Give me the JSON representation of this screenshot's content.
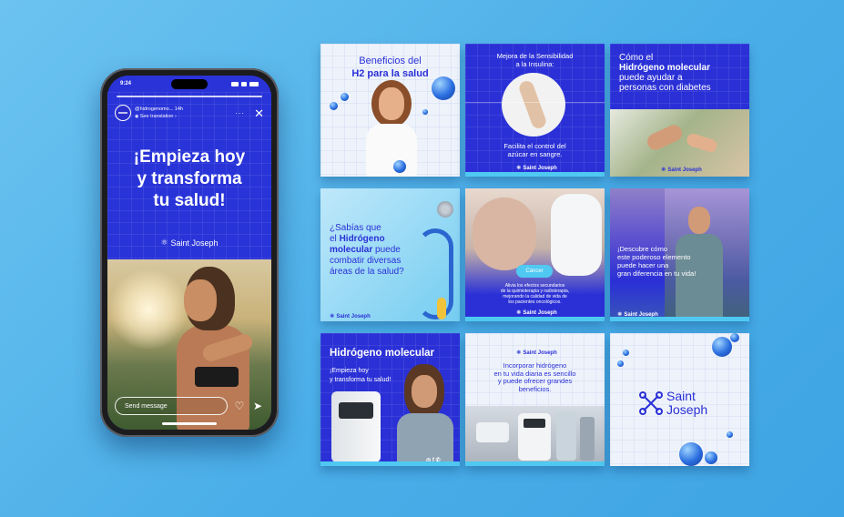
{
  "phone": {
    "status_time": "9:24",
    "story": {
      "username": "@hidrogenomo... 14h",
      "see_translation": "See translation",
      "title_lines": [
        "¡Empieza hoy",
        "y transforma",
        "tu salud!"
      ],
      "brand": "Saint Joseph",
      "send_placeholder": "Send message"
    }
  },
  "tiles": {
    "t1": {
      "line1": "Beneficios del",
      "line2": "H2 para la salud"
    },
    "t2": {
      "top1": "Mejora de la Sensibilidad",
      "top2": "a la Insulina:",
      "bottom1": "Facilita el control del",
      "bottom2": "azúcar en sangre.",
      "brand": "Saint Joseph"
    },
    "t3": {
      "l1": "Cómo el",
      "l2": "Hidrógeno molecular",
      "l3": "puede ayudar a",
      "l4": "personas con diabetes",
      "brand": "Saint Joseph"
    },
    "t4": {
      "l1": "¿Sabías que",
      "l2a": "el ",
      "l2b": "Hidrógeno",
      "l3a": "molecular",
      "l3b": " puede",
      "l4": "combatir diversas",
      "l5": "áreas de la salud?",
      "brand": "Saint Joseph"
    },
    "t5": {
      "pill": "Cáncer",
      "b1": "Alivia los efectos secundarios",
      "b2": "de la quimioterapia y radioterapia,",
      "b3": "mejorando la calidad de vida de",
      "b4": "los pacientes oncológicos.",
      "brand": "Saint Joseph"
    },
    "t6": {
      "l1": "¡Descubre cómo",
      "l2": "este poderoso elemento",
      "l3": "puede hacer una",
      "l4": "gran diferencia en tu vida!",
      "brand": "Saint Joseph"
    },
    "t7": {
      "title": "Hidrógeno molecular",
      "s1": "¡Empieza hoy",
      "s2": "y transforma tu salud!",
      "social": "◎ f ✆"
    },
    "t8": {
      "brand": "Saint Joseph",
      "l1": "Incorporar hidrógeno",
      "l2": "en tu vida diaria es sencillo",
      "l3": "y puede ofrecer grandes",
      "l4": "beneficios."
    },
    "t9": {
      "brand1": "Saint",
      "brand2": "Joseph"
    }
  },
  "colors": {
    "brand_blue": "#2a30d6",
    "accent_cyan": "#4fc9f2",
    "background": "#55b4ea"
  },
  "icons": [
    "molecule-logo-icon",
    "heart-icon",
    "send-icon",
    "close-icon",
    "more-icon"
  ]
}
